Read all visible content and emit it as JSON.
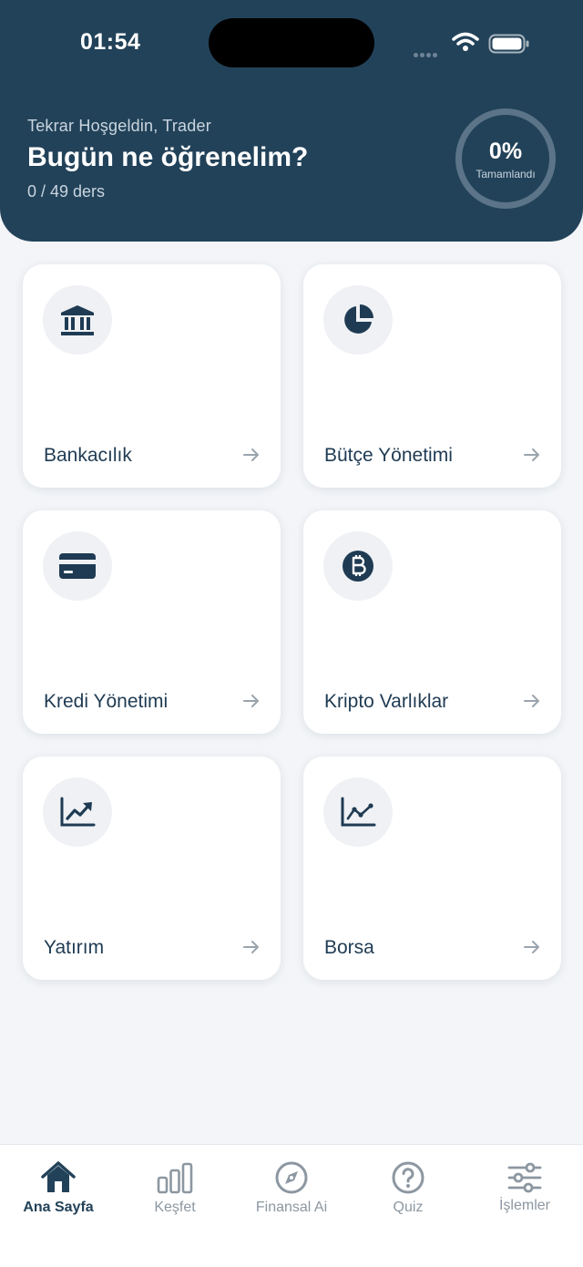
{
  "status_bar": {
    "time": "01:54"
  },
  "header": {
    "greeting": "Tekrar Hoşgeldin, Trader",
    "title": "Bugün ne öğrenelim?",
    "lessons": "0 / 49 ders",
    "progress_value": "0%",
    "progress_label": "Tamamlandı",
    "progress_fraction": 0
  },
  "categories": [
    {
      "label": "Bankacılık",
      "icon": "bank-icon"
    },
    {
      "label": "Bütçe Yönetimi",
      "icon": "pie-chart-icon"
    },
    {
      "label": "Kredi Yönetimi",
      "icon": "credit-card-icon"
    },
    {
      "label": "Kripto Varlıklar",
      "icon": "bitcoin-icon"
    },
    {
      "label": "Yatırım",
      "icon": "trending-up-icon"
    },
    {
      "label": "Borsa",
      "icon": "line-chart-icon"
    }
  ],
  "tabbar": {
    "items": [
      {
        "label": "Ana Sayfa",
        "icon": "home-icon",
        "active": true
      },
      {
        "label": "Keşfet",
        "icon": "bar-chart-icon",
        "active": false
      },
      {
        "label": "Finansal Ai",
        "icon": "compass-icon",
        "active": false
      },
      {
        "label": "Quiz",
        "icon": "question-icon",
        "active": false
      },
      {
        "label": "İşlemler",
        "icon": "sliders-icon",
        "active": false
      }
    ]
  },
  "colors": {
    "header_bg": "#224259",
    "accent": "#224259",
    "inactive": "#8c97a1",
    "background": "#f3f5f8"
  }
}
